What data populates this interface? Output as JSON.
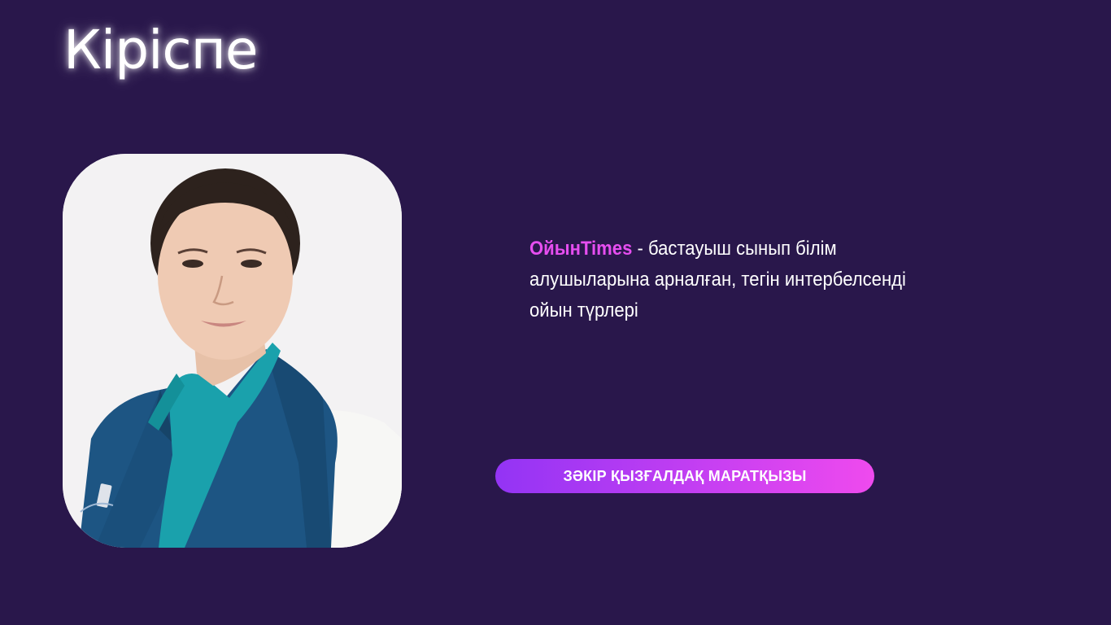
{
  "title": "Кіріспе",
  "intro": {
    "brand": "ОйынTimes",
    "text": " - бастауыш сынып білім алушыларына арналған, тегін интербелсенді ойын түрлері"
  },
  "author_badge": "ЗӘКІР ҚЫЗҒАЛДАҚ МАРАТҚЫЗЫ",
  "colors": {
    "background": "#29174b",
    "brand": "#e64ef0",
    "badge_gradient_start": "#9334f4",
    "badge_gradient_end": "#ef4aee"
  }
}
